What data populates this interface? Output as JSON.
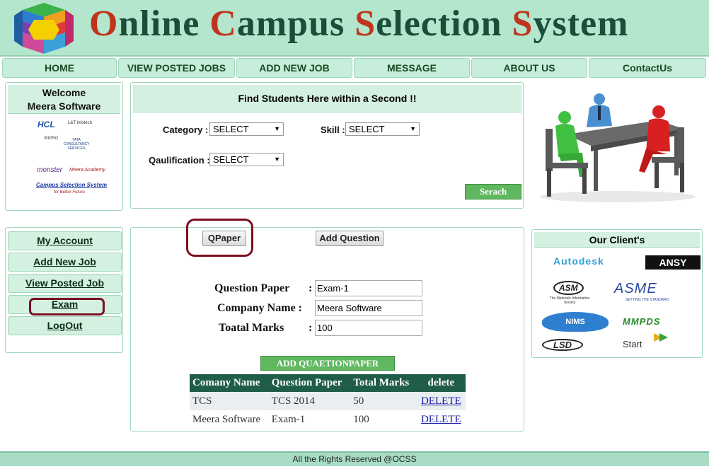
{
  "header": {
    "title_parts": [
      {
        "cap": "O",
        "rest": "nline "
      },
      {
        "cap": "C",
        "rest": "ampus "
      },
      {
        "cap": "S",
        "rest": "election "
      },
      {
        "cap": "S",
        "rest": "ystem"
      }
    ],
    "logo_icon": "hexagon-cube-logo-icon"
  },
  "nav": {
    "items": [
      {
        "label": "HOME"
      },
      {
        "label": "VIEW POSTED JOBS"
      },
      {
        "label": "ADD NEW JOB"
      },
      {
        "label": "MESSAGE"
      },
      {
        "label": "ABOUT US"
      },
      {
        "label": "ContactUs"
      }
    ]
  },
  "welcome": {
    "line1": "Welcome",
    "line2": "Meera Software",
    "partner_logos": [
      "HCL",
      "L&T Infotech",
      "WIPRO",
      "TATA CONSULTANCY SERVICES",
      "monster",
      "Meera Academy",
      "Campus Selection System",
      "for Better Future."
    ]
  },
  "search": {
    "title": "Find Students Here within a Second !!",
    "category_label": "Category  :",
    "category_value": "SELECT",
    "skill_label": "Skill :",
    "skill_value": "SELECT",
    "qualification_label": "Qaulification :",
    "qualification_value": "SELECT",
    "search_button": "Serach"
  },
  "menu": {
    "items": [
      {
        "label": "My Account"
      },
      {
        "label": "Add New Job"
      },
      {
        "label": "View Posted Job"
      },
      {
        "label": "Exam"
      },
      {
        "label": "LogOut"
      }
    ]
  },
  "main": {
    "qpaper_button": "QPaper",
    "add_question_button": "Add Question",
    "form": {
      "question_paper_label": "Question Paper",
      "question_paper_value": "Exam-1",
      "company_name_label": "Company Name :",
      "company_name_value": "Meera Software",
      "total_marks_label": "Toatal Marks",
      "total_marks_value": "100",
      "colon": ":"
    },
    "add_button": "ADD QUAETIONPAPER",
    "table": {
      "headers": [
        "Comany Name",
        "Question Paper",
        "Total Marks",
        "delete"
      ],
      "rows": [
        [
          "TCS",
          "TCS 2014",
          "50",
          "DELETE"
        ],
        [
          "Meera Software",
          "Exam-1",
          "100",
          "DELETE"
        ]
      ]
    }
  },
  "clients": {
    "title": "Our Client's",
    "logos": [
      "Autodesk",
      "ANSY",
      "ASM",
      "The Materials Information Society",
      "ASME",
      "SETTING THE STANDARD",
      "NIMS",
      "MMPDS",
      "LSD",
      "Start"
    ]
  },
  "footer": {
    "text": "All the Rights Reserved @OCSS"
  },
  "colors": {
    "header_bg": "#b3e6cc",
    "title_green": "#1a4d3a",
    "title_red": "#c0341d",
    "nav_bg": "#c6eedb",
    "table_header": "#1f5c4a",
    "button_green": "#5fb85f",
    "highlight_ring": "#7a1020"
  }
}
